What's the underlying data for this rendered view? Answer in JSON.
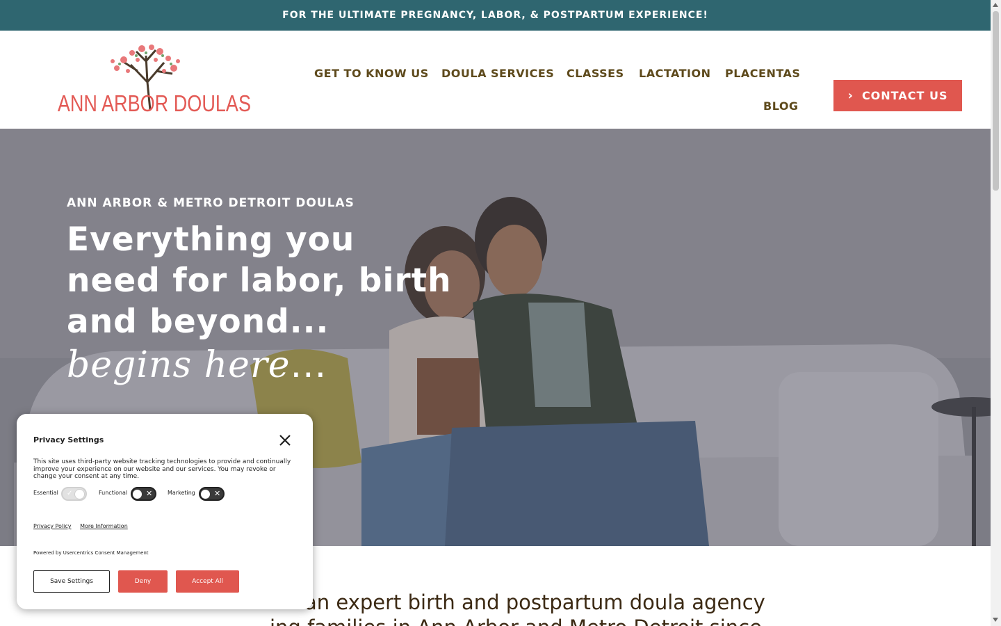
{
  "topbar": {
    "text": "FOR THE ULTIMATE PREGNANCY, LABOR, & POSTPARTUM EXPERIENCE!"
  },
  "header": {
    "logo_text": "ANN ARBOR DOULAS",
    "nav": [
      {
        "label": "GET TO KNOW US"
      },
      {
        "label": "DOULA SERVICES"
      },
      {
        "label": "CLASSES"
      },
      {
        "label": "LACTATION"
      },
      {
        "label": "PLACENTAS"
      },
      {
        "label": "BLOG"
      }
    ],
    "cta_label": "CONTACT US"
  },
  "hero": {
    "eyebrow": "ANN ARBOR & METRO DETROIT DOULAS",
    "title": "Everything you need for labor, birth and beyond...",
    "script": "begins here",
    "script_dots": "..."
  },
  "intro": {
    "line1": "an expert birth and postpartum doula agency",
    "line2": "ing families in Ann Arbor and Metro Detroit since"
  },
  "privacy": {
    "title": "Privacy Settings",
    "text": "This site uses third-party website tracking technologies to provide and continually improve your experience on our website and our services. You may revoke or change your consent at any time.",
    "toggles": [
      {
        "label": "Essential",
        "on": true
      },
      {
        "label": "Functional",
        "on": false
      },
      {
        "label": "Marketing",
        "on": false
      }
    ],
    "links": {
      "policy": "Privacy Policy",
      "more": "More Information"
    },
    "powered": "Powered by Usercentrics Consent Management",
    "buttons": {
      "save": "Save Settings",
      "deny": "Deny",
      "accept": "Accept All"
    }
  },
  "colors": {
    "topbar": "#2f6670",
    "accent": "#e0574f",
    "nav_text": "#5e4a1c"
  }
}
